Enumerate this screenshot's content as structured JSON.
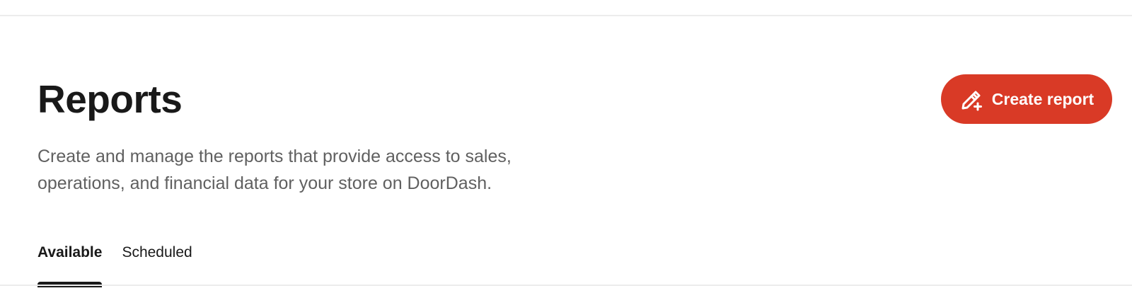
{
  "header": {
    "title": "Reports",
    "description": "Create and manage the reports that provide access to sales, operations, and financial data for your store on DoorDash.",
    "create_button_label": "Create report",
    "create_button_icon": "pencil-plus-icon"
  },
  "tabs": [
    {
      "label": "Available",
      "selected": true
    },
    {
      "label": "Scheduled",
      "selected": false
    }
  ],
  "colors": {
    "accent": "#d93a26",
    "text_primary": "#191919",
    "text_secondary": "#606060"
  }
}
